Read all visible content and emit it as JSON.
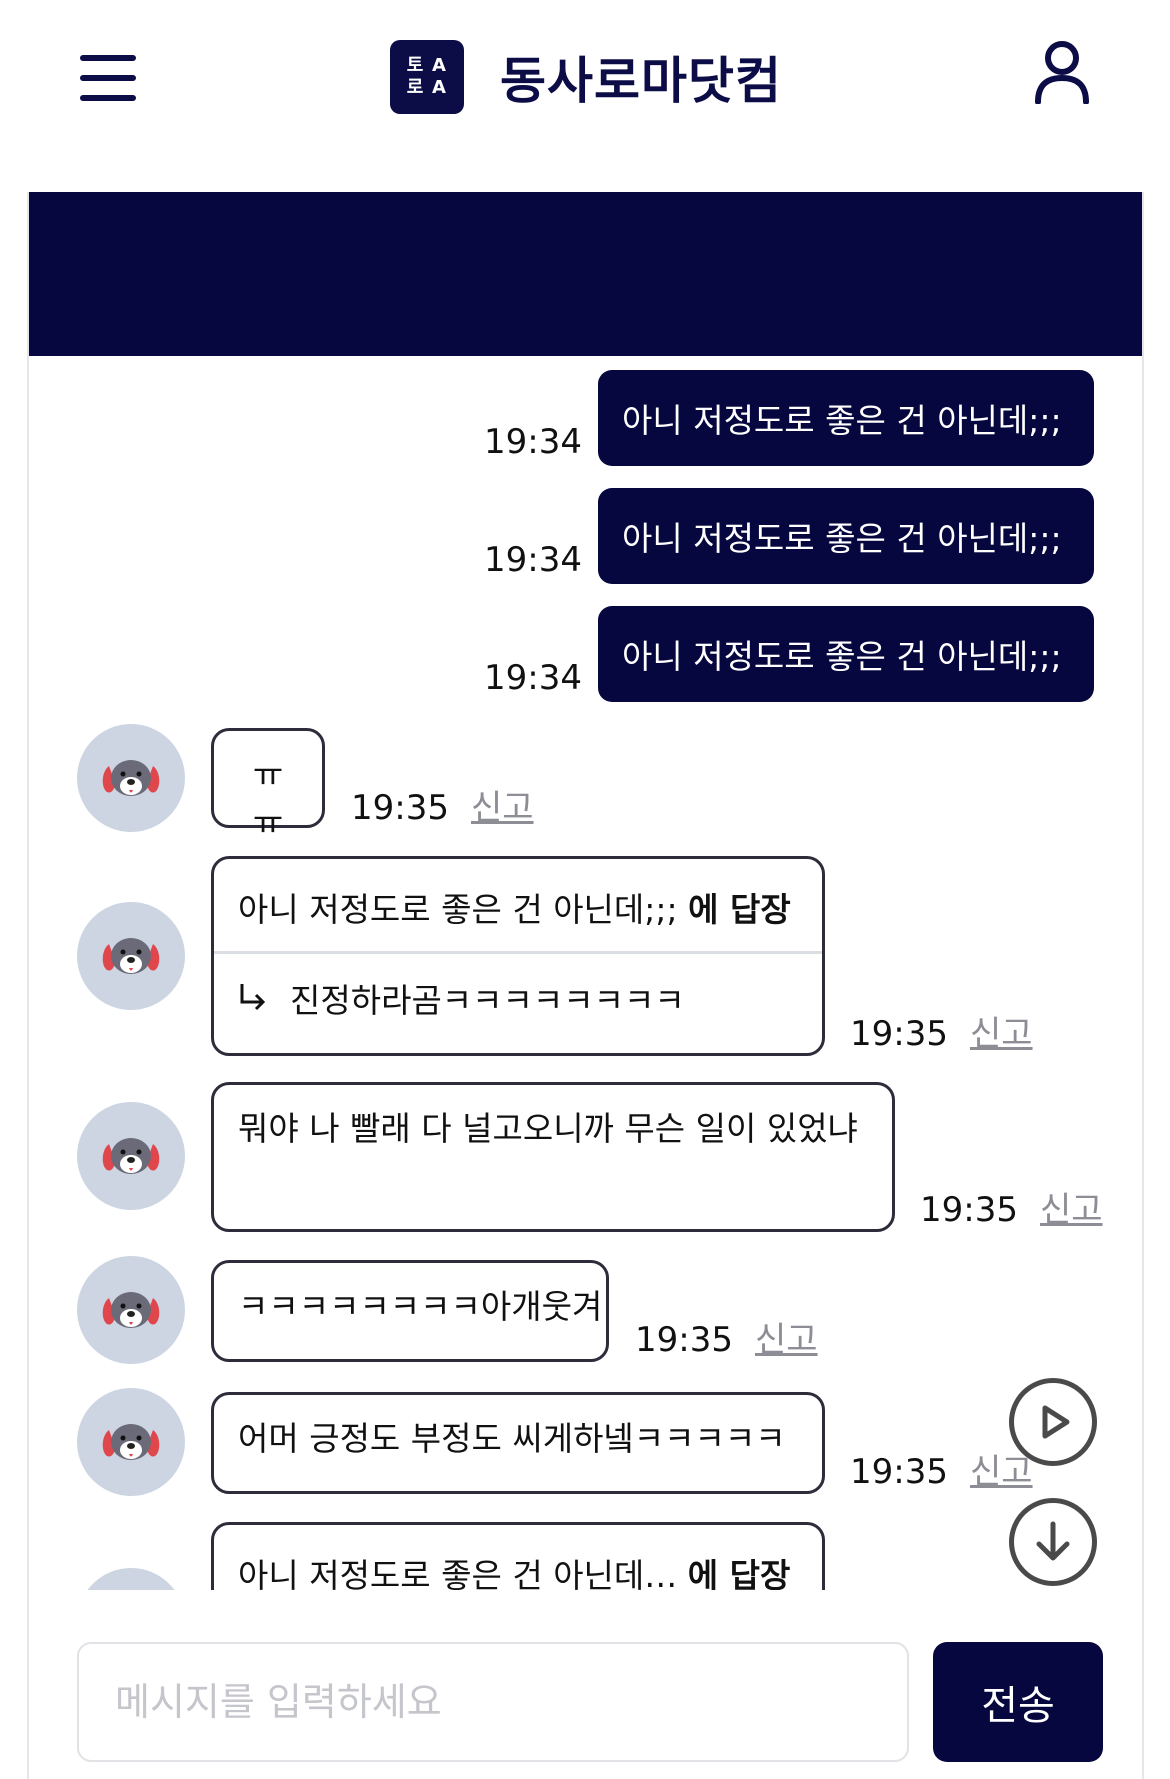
{
  "app": {
    "brand_name": "동사로마닷컴",
    "logo_glyphs": [
      "토",
      "A",
      "로",
      "A"
    ]
  },
  "colors": {
    "navy": "#07073f",
    "avatar_bg": "#cdd5e3",
    "report_link": "#8d8d95"
  },
  "icons": {
    "menu": "hamburger-icon",
    "user": "user-icon",
    "play": "play-circle-icon",
    "down": "arrow-down-circle-icon",
    "reply": "reply-arrow-icon"
  },
  "my_messages": [
    {
      "text": "아니 저정도로 좋은 건 아닌데;;;",
      "time": "19:34"
    },
    {
      "text": "아니 저정도로 좋은 건 아닌데;;;",
      "time": "19:34"
    },
    {
      "text": "아니 저정도로 좋은 건 아닌데;;;",
      "time": "19:34"
    }
  ],
  "messages": [
    {
      "text": "ㅠㅠ",
      "time": "19:35",
      "report": "신고"
    },
    {
      "reply_to": "아니 저정도로 좋은 건 아닌데;;;",
      "reply_suffix": "에 답장",
      "text": "진정하라곰ㅋㅋㅋㅋㅋㅋㅋㅋ",
      "time": "19:35",
      "report": "신고"
    },
    {
      "text": "뭐야 나 빨래 다 널고오니까 무슨 일이 있었냐",
      "time": "19:35",
      "report": "신고"
    },
    {
      "text": "ㅋㅋㅋㅋㅋㅋㅋㅋ아개웃겨",
      "time": "19:35",
      "report": "신고"
    },
    {
      "text": "어머 긍정도 부정도 씨게하넼ㅋㅋㅋㅋㅋ",
      "time": "19:35",
      "report": "신고"
    },
    {
      "reply_to": "아니 저정도로 좋은 건 아닌데…",
      "reply_suffix": "에 답장"
    }
  ],
  "composer": {
    "placeholder": "메시지를 입력하세요",
    "send_label": "전송"
  }
}
